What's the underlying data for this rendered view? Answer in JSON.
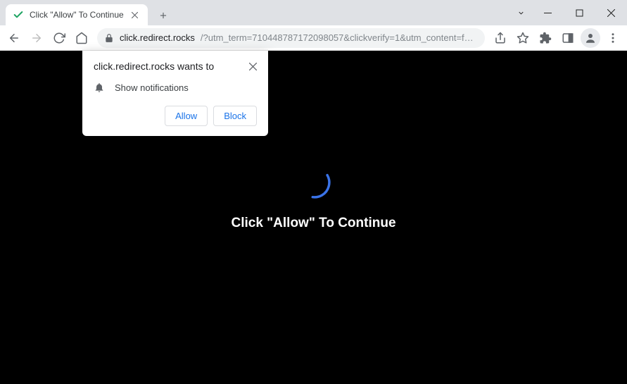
{
  "tab": {
    "title": "Click \"Allow\" To Continue"
  },
  "url": {
    "host": "click.redirect.rocks",
    "rest": "/?utm_term=710448787172098057&clickverify=1&utm_content=fdc2c69a9cafac9c979096a..."
  },
  "page": {
    "headline": "Click \"Allow\" To Continue"
  },
  "prompt": {
    "origin_text": "click.redirect.rocks wants to",
    "permission_label": "Show notifications",
    "allow_label": "Allow",
    "block_label": "Block"
  }
}
